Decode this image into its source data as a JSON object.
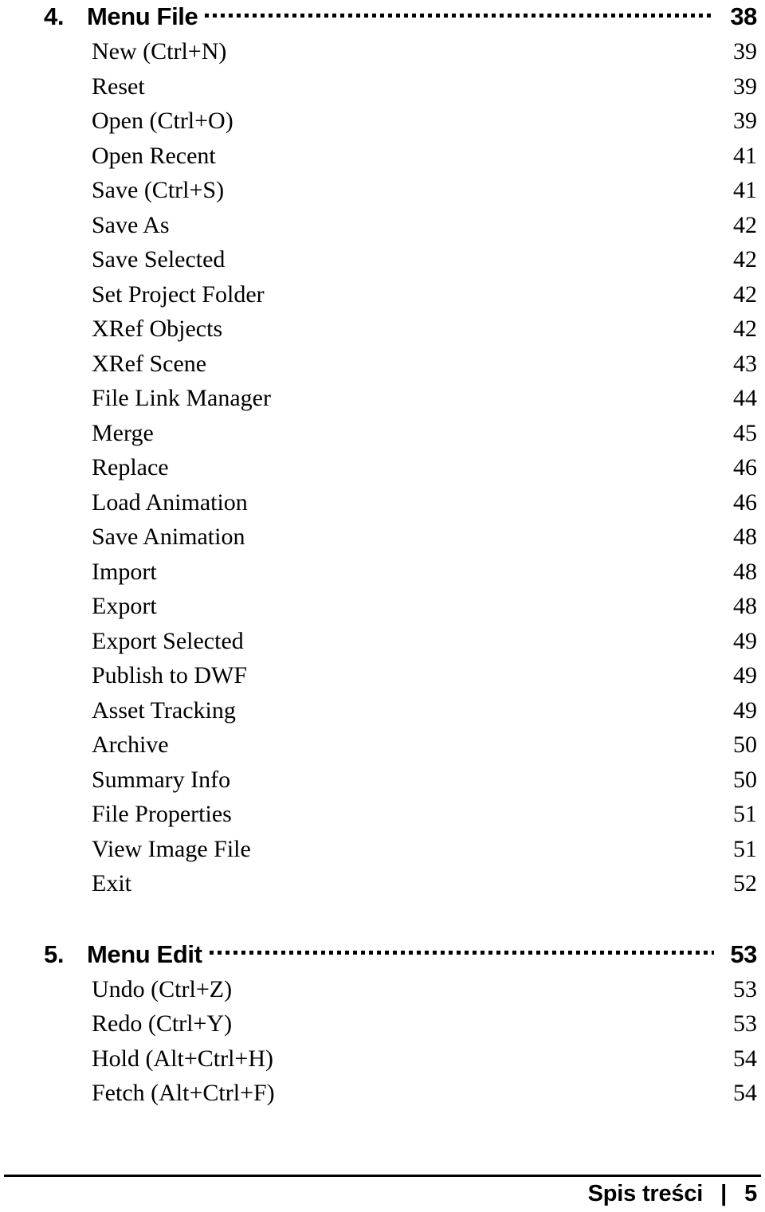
{
  "document": {
    "type": "table-of-contents"
  },
  "sections": [
    {
      "number": "4.",
      "title": "Menu File",
      "page": "38",
      "entries": [
        {
          "label": "New (Ctrl+N)",
          "page": "39"
        },
        {
          "label": "Reset",
          "page": "39"
        },
        {
          "label": "Open (Ctrl+O)",
          "page": "39"
        },
        {
          "label": "Open Recent",
          "page": "41"
        },
        {
          "label": "Save (Ctrl+S)",
          "page": "41"
        },
        {
          "label": "Save As",
          "page": "42"
        },
        {
          "label": "Save Selected",
          "page": "42"
        },
        {
          "label": "Set Project Folder",
          "page": "42"
        },
        {
          "label": "XRef Objects",
          "page": "42"
        },
        {
          "label": "XRef Scene",
          "page": "43"
        },
        {
          "label": "File Link Manager",
          "page": "44"
        },
        {
          "label": "Merge",
          "page": "45"
        },
        {
          "label": "Replace",
          "page": "46"
        },
        {
          "label": "Load Animation",
          "page": "46"
        },
        {
          "label": "Save Animation",
          "page": "48"
        },
        {
          "label": "Import",
          "page": "48"
        },
        {
          "label": "Export",
          "page": "48"
        },
        {
          "label": "Export Selected",
          "page": "49"
        },
        {
          "label": "Publish to DWF",
          "page": "49"
        },
        {
          "label": "Asset Tracking",
          "page": "49"
        },
        {
          "label": "Archive",
          "page": "50"
        },
        {
          "label": "Summary Info",
          "page": "50"
        },
        {
          "label": "File Properties",
          "page": "51"
        },
        {
          "label": "View Image File",
          "page": "51"
        },
        {
          "label": "Exit",
          "page": "52"
        }
      ]
    },
    {
      "number": "5.",
      "title": "Menu Edit",
      "page": "53",
      "entries": [
        {
          "label": "Undo (Ctrl+Z)",
          "page": "53"
        },
        {
          "label": "Redo (Ctrl+Y)",
          "page": "53"
        },
        {
          "label": "Hold (Alt+Ctrl+H)",
          "page": "54"
        },
        {
          "label": "Fetch (Alt+Ctrl+F)",
          "page": "54"
        }
      ]
    }
  ],
  "footer": {
    "label": "Spis treści",
    "separator": "|",
    "page": "5"
  },
  "colors": {
    "text": "#000000",
    "background": "#ffffff",
    "rule": "#000000"
  }
}
